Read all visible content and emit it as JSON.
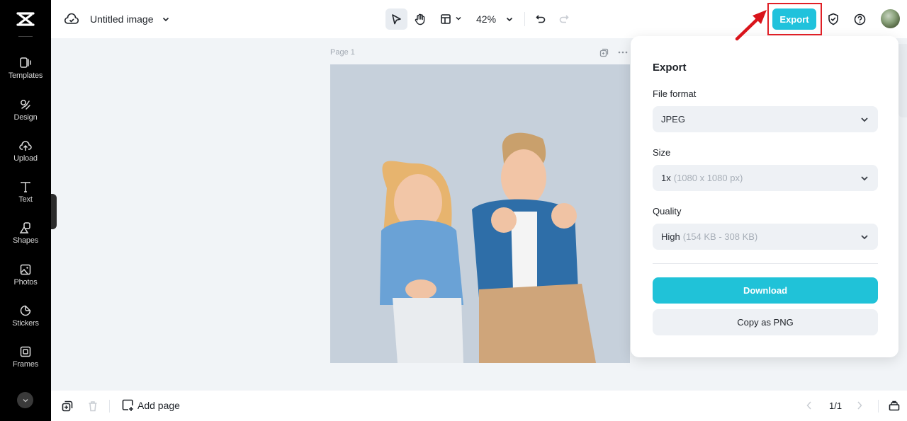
{
  "app": {
    "logo": "capcut-logo-icon",
    "document_title": "Untitled image",
    "accent_color": "#20c2dc"
  },
  "sidebar": {
    "items": [
      {
        "label": "Templates",
        "icon": "templates-icon"
      },
      {
        "label": "Design",
        "icon": "design-icon"
      },
      {
        "label": "Upload",
        "icon": "upload-icon"
      },
      {
        "label": "Text",
        "icon": "text-icon"
      },
      {
        "label": "Shapes",
        "icon": "shapes-icon"
      },
      {
        "label": "Photos",
        "icon": "photos-icon"
      },
      {
        "label": "Stickers",
        "icon": "stickers-icon"
      },
      {
        "label": "Frames",
        "icon": "frames-icon"
      }
    ],
    "more_icon": "chevron-down-icon"
  },
  "toolbar": {
    "zoom_level": "42%",
    "export_label": "Export"
  },
  "canvas": {
    "page_label": "Page 1",
    "image_description": "Two children, a blonde girl in a polka-dot denim shirt and a boy in a denim jacket, sitting on a light blue-grey background"
  },
  "bottombar": {
    "add_page_label": "Add page",
    "page_indicator": "1/1"
  },
  "export_panel": {
    "title": "Export",
    "file_format": {
      "label": "File format",
      "value": "JPEG"
    },
    "size": {
      "label": "Size",
      "value": "1x",
      "detail": "(1080 x 1080 px)"
    },
    "quality": {
      "label": "Quality",
      "value": "High",
      "detail": "(154 KB - 308 KB)"
    },
    "download_label": "Download",
    "copy_label": "Copy as PNG"
  },
  "annotation": {
    "highlight_color": "#e01f26",
    "target": "Export button"
  }
}
